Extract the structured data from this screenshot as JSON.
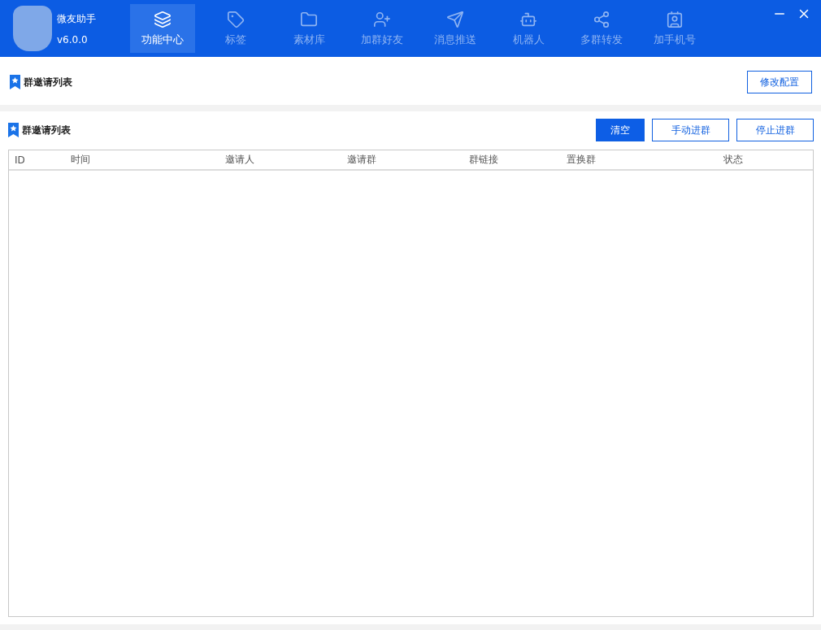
{
  "app": {
    "name": "微友助手",
    "version": "v6.0.0"
  },
  "nav": [
    {
      "label": "功能中心",
      "selected": true
    },
    {
      "label": "标签",
      "selected": false
    },
    {
      "label": "素材库",
      "selected": false
    },
    {
      "label": "加群好友",
      "selected": false
    },
    {
      "label": "消息推送",
      "selected": false
    },
    {
      "label": "机器人",
      "selected": false
    },
    {
      "label": "多群转发",
      "selected": false
    },
    {
      "label": "加手机号",
      "selected": false
    }
  ],
  "config_panel": {
    "title": "群邀请列表",
    "button": "修改配置"
  },
  "list_panel": {
    "title": "群邀请列表",
    "buttons": [
      {
        "label": "清空",
        "primary": true
      },
      {
        "label": "手动进群",
        "primary": false
      },
      {
        "label": "停止进群",
        "primary": false
      }
    ],
    "table": {
      "columns": [
        "ID",
        "时间",
        "邀请人",
        "邀请群",
        "群链接",
        "置换群",
        "状态"
      ]
    }
  }
}
